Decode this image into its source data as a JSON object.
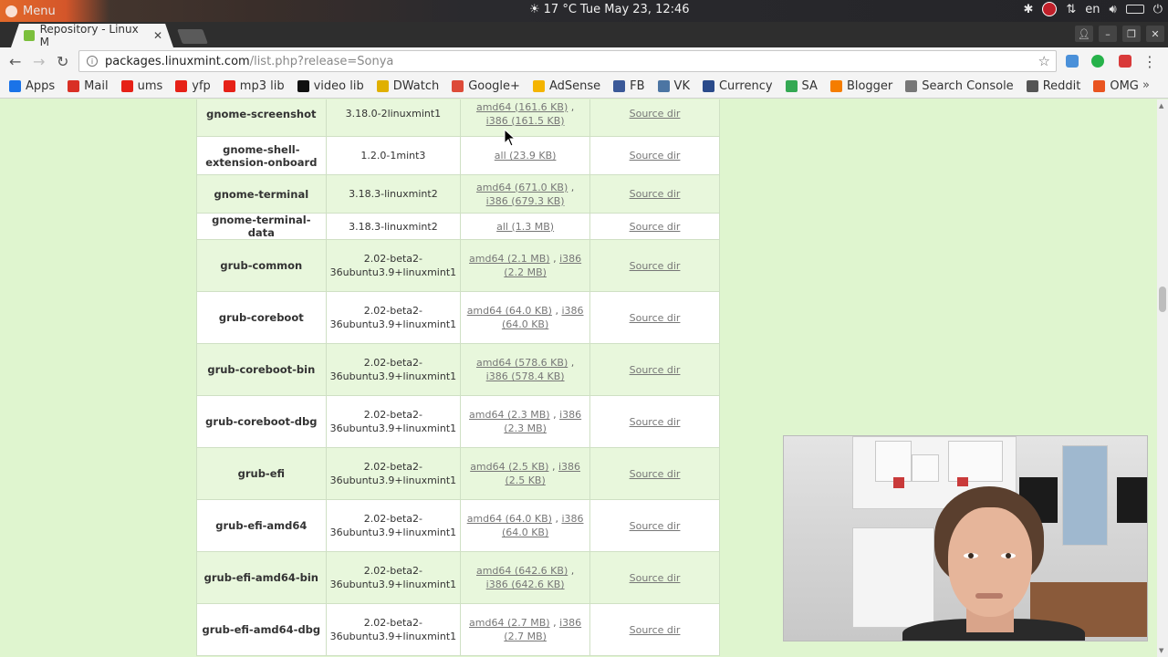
{
  "os_panel": {
    "menu_label": "Menu",
    "weather": "17 °C",
    "datetime": "Tue May 23, 12:46",
    "lang": "en"
  },
  "browser": {
    "tab_title": "Repository - Linux M",
    "url_host": "packages.linuxmint.com",
    "url_path": "/list.php?release=Sonya"
  },
  "bookmarks": [
    {
      "label": "Apps",
      "color": "#1a73e8"
    },
    {
      "label": "Mail",
      "color": "#d93025"
    },
    {
      "label": "ums",
      "color": "#e62117"
    },
    {
      "label": "yfp",
      "color": "#e62117"
    },
    {
      "label": "mp3 lib",
      "color": "#e62117"
    },
    {
      "label": "video lib",
      "color": "#111111"
    },
    {
      "label": "DWatch",
      "color": "#e0b000"
    },
    {
      "label": "Google+",
      "color": "#dd4b39"
    },
    {
      "label": "AdSense",
      "color": "#f4b400"
    },
    {
      "label": "FB",
      "color": "#3b5998"
    },
    {
      "label": "VK",
      "color": "#4c75a3"
    },
    {
      "label": "Currency",
      "color": "#2a4a8a"
    },
    {
      "label": "SA",
      "color": "#34a853"
    },
    {
      "label": "Blogger",
      "color": "#f57d00"
    },
    {
      "label": "Search Console",
      "color": "#777777"
    },
    {
      "label": "Reddit",
      "color": "#555555"
    },
    {
      "label": "OMG",
      "color": "#e95420"
    }
  ],
  "packages": [
    {
      "name": "gnome-screenshot",
      "version": "3.18.0-2linuxmint1",
      "files": [
        {
          "label": "amd64 (161.6 KB)"
        },
        {
          "label": "i386 (161.5 KB)"
        }
      ],
      "source": "Source dir",
      "h": 50
    },
    {
      "name": "gnome-shell-extension-onboard",
      "version": "1.2.0-1mint3",
      "files": [
        {
          "label": "all (23.9 KB)"
        }
      ],
      "source": "Source dir",
      "h": 42
    },
    {
      "name": "gnome-terminal",
      "version": "3.18.3-linuxmint2",
      "files": [
        {
          "label": "amd64 (671.0 KB)"
        },
        {
          "label": "i386 (679.3 KB)"
        }
      ],
      "source": "Source dir",
      "h": 42
    },
    {
      "name": "gnome-terminal-data",
      "version": "3.18.3-linuxmint2",
      "files": [
        {
          "label": "all (1.3 MB)"
        }
      ],
      "source": "Source dir",
      "h": 28
    },
    {
      "name": "grub-common",
      "version": "2.02-beta2-36ubuntu3.9+linuxmint1",
      "files": [
        {
          "label": "amd64 (2.1 MB)"
        },
        {
          "label": "i386 (2.2 MB)"
        }
      ],
      "source": "Source dir",
      "h": 57
    },
    {
      "name": "grub-coreboot",
      "version": "2.02-beta2-36ubuntu3.9+linuxmint1",
      "files": [
        {
          "label": "amd64 (64.0 KB)"
        },
        {
          "label": "i386 (64.0 KB)"
        }
      ],
      "source": "Source dir",
      "h": 57
    },
    {
      "name": "grub-coreboot-bin",
      "version": "2.02-beta2-36ubuntu3.9+linuxmint1",
      "files": [
        {
          "label": "amd64 (578.6 KB)"
        },
        {
          "label": "i386 (578.4 KB)"
        }
      ],
      "source": "Source dir",
      "h": 57
    },
    {
      "name": "grub-coreboot-dbg",
      "version": "2.02-beta2-36ubuntu3.9+linuxmint1",
      "files": [
        {
          "label": "amd64 (2.3 MB)"
        },
        {
          "label": "i386 (2.3 MB)"
        }
      ],
      "source": "Source dir",
      "h": 57
    },
    {
      "name": "grub-efi",
      "version": "2.02-beta2-36ubuntu3.9+linuxmint1",
      "files": [
        {
          "label": "amd64 (2.5 KB)"
        },
        {
          "label": "i386 (2.5 KB)"
        }
      ],
      "source": "Source dir",
      "h": 57
    },
    {
      "name": "grub-efi-amd64",
      "version": "2.02-beta2-36ubuntu3.9+linuxmint1",
      "files": [
        {
          "label": "amd64 (64.0 KB)"
        },
        {
          "label": "i386 (64.0 KB)"
        }
      ],
      "source": "Source dir",
      "h": 57
    },
    {
      "name": "grub-efi-amd64-bin",
      "version": "2.02-beta2-36ubuntu3.9+linuxmint1",
      "files": [
        {
          "label": "amd64 (642.6 KB)"
        },
        {
          "label": "i386 (642.6 KB)"
        }
      ],
      "source": "Source dir",
      "h": 57
    },
    {
      "name": "grub-efi-amd64-dbg",
      "version": "2.02-beta2-36ubuntu3.9+linuxmint1",
      "files": [
        {
          "label": "amd64 (2.7 MB)"
        },
        {
          "label": "i386 (2.7 MB)"
        }
      ],
      "source": "Source dir",
      "h": 57
    }
  ]
}
